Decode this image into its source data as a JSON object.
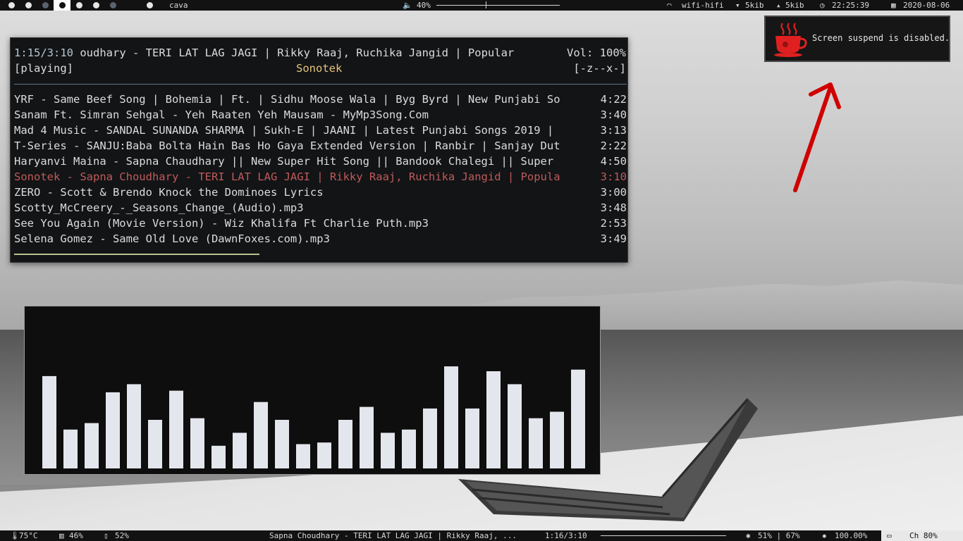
{
  "topbar": {
    "workspaces": [
      {
        "state": "normal"
      },
      {
        "state": "normal"
      },
      {
        "state": "dim"
      },
      {
        "state": "dim"
      },
      {
        "state": "active"
      },
      {
        "state": "normal"
      },
      {
        "state": "normal"
      },
      {
        "state": "dim"
      },
      {
        "state": "normal"
      }
    ],
    "window_title": "cava",
    "volume_icon": "speaker-icon",
    "volume": "40%",
    "volume_level": 0.4,
    "wifi_icon": "wifi-icon",
    "wifi": "wifi-hifi",
    "down_icon": "download-arrow-icon",
    "down": "5kib",
    "up_icon": "upload-arrow-icon",
    "up": "5kib",
    "clock_icon": "clock-icon",
    "time": "22:25:39",
    "calendar_icon": "calendar-icon",
    "date": "2020-08-06"
  },
  "notification": {
    "icon": "coffee-cup-icon",
    "icon_color": "#e02020",
    "text": "Screen suspend is disabled."
  },
  "player": {
    "elapsed": "1:15/3:10",
    "now_playing": "oudhary - TERI LAT LAG JAGI | Rikky Raaj, Ruchika Jangid | Popular",
    "volume": "Vol: 100%",
    "state": "[playing]",
    "artist": "Sonotek",
    "flags": "[-z--x-]",
    "progress": 0.4,
    "current_color": "#c05a5a",
    "tracks": [
      {
        "title": "YRF - Same Beef Song | Bohemia | Ft. | Sidhu Moose Wala | Byg Byrd | New Punjabi So",
        "duration": "4:22"
      },
      {
        "title": "Sanam Ft. Simran Sehgal - Yeh Raaten Yeh Mausam - MyMp3Song.Com",
        "duration": "3:40"
      },
      {
        "title": "Mad 4 Music - SANDAL SUNANDA SHARMA | Sukh-E | JAANI | Latest Punjabi Songs 2019 |",
        "duration": "3:13"
      },
      {
        "title": "T-Series - SANJU:Baba Bolta Hain Bas Ho Gaya Extended Version | Ranbir | Sanjay Dut",
        "duration": "2:22"
      },
      {
        "title": "Haryanvi Maina - Sapna Chaudhary || New Super Hit Song || Bandook Chalegi || Super",
        "duration": "4:50"
      },
      {
        "title": "Sonotek - Sapna Choudhary - TERI LAT LAG JAGI | Rikky Raaj, Ruchika Jangid | Popula",
        "duration": "3:10",
        "current": true
      },
      {
        "title": "ZERO - Scott & Brendo Knock the Dominoes Lyrics",
        "duration": "3:00"
      },
      {
        "title": "Scotty_McCreery_-_Seasons_Change_(Audio).mp3",
        "duration": "3:48"
      },
      {
        "title": "See You Again (Movie Version) - Wiz Khalifa Ft Charlie Puth.mp3",
        "duration": "2:53"
      },
      {
        "title": "Selena Gomez - Same Old Love (DawnFoxes.com).mp3",
        "duration": "3:49"
      }
    ]
  },
  "visualizer": {
    "bar_color": "#e4e6ee",
    "levels": [
      0.57,
      0.24,
      0.28,
      0.47,
      0.52,
      0.3,
      0.48,
      0.31,
      0.14,
      0.22,
      0.41,
      0.3,
      0.15,
      0.16,
      0.3,
      0.38,
      0.22,
      0.24,
      0.37,
      0.63,
      0.37,
      0.6,
      0.52,
      0.31,
      0.35,
      0.61
    ]
  },
  "annotation": {
    "arrow_color": "#d00000"
  },
  "bottombar": {
    "temp_icon": "thermometer-icon",
    "temp": "75°C",
    "memory_icon": "memory-icon",
    "memory": "46%",
    "disk_icon": "storage-icon",
    "disk": "52%",
    "song": "Sapna Choudhary - TERI LAT LAG JAGI | Rikky Raaj, ...",
    "song_time": "1:16/3:10",
    "song_progress": 0.4,
    "brightness_icon": "brightness-icon",
    "brightness": "51% | 67%",
    "gamma_icon": "sun-icon",
    "gamma": "100.00%",
    "battery_icon": "battery-icon",
    "battery": "Ch 80%"
  }
}
